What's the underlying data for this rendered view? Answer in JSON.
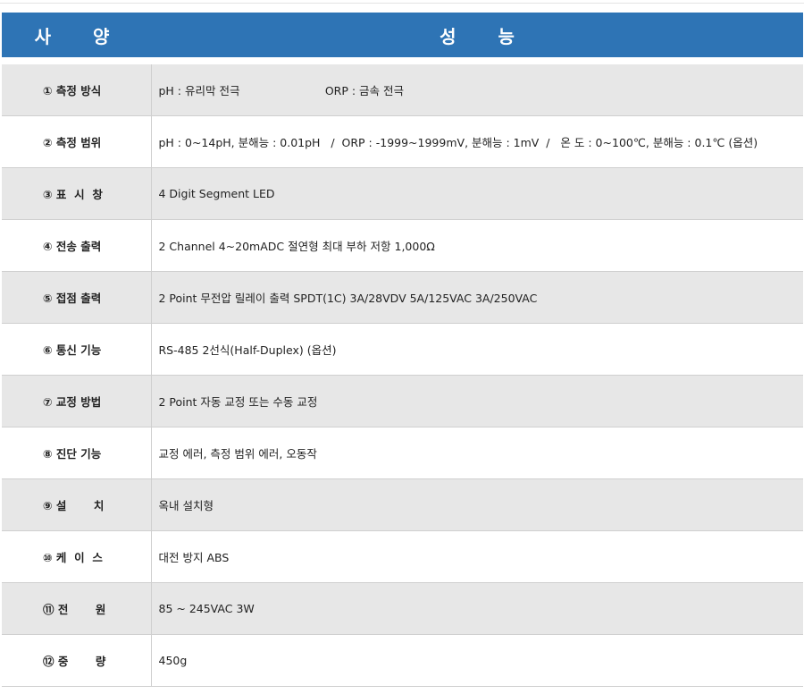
{
  "header": {
    "item_label": "사 양",
    "perf_label": "성 능"
  },
  "rows": [
    {
      "item": "① 측정 방식",
      "perf": "pH : 유리막 전극                        ORP : 금속 전극"
    },
    {
      "item": "② 측정 범위",
      "perf": "pH : 0~14pH, 분해능 : 0.01pH   /  ORP : -1999~1999mV, 분해능 : 1mV  /   온 도 : 0~100℃, 분해능 : 0.1℃ (옵션)"
    },
    {
      "item": "③ 표  시  창",
      "perf": "4 Digit Segment LED"
    },
    {
      "item": "④ 전송 출력",
      "perf": "2 Channel 4~20mADC 절연형 최대 부하 저항 1,000Ω"
    },
    {
      "item": "⑤ 접점 출력",
      "perf": "2 Point 무전압 릴레이 출력 SPDT(1C) 3A/28VDV 5A/125VAC 3A/250VAC"
    },
    {
      "item": "⑥ 통신 기능",
      "perf": "RS-485 2선식(Half-Duplex) (옵션)"
    },
    {
      "item": "⑦ 교정 방법",
      "perf": "2 Point 자동 교정 또는 수동 교정"
    },
    {
      "item": "⑧ 진단 기능",
      "perf": "교정 에러, 측정 범위 에러, 오동작"
    },
    {
      "item": "⑨ 설       치",
      "perf": "옥내 설치형"
    },
    {
      "item": "⑩ 케  이  스",
      "perf": "대전 방지 ABS"
    },
    {
      "item": "⑪ 전       원",
      "perf": "85 ~ 245VAC 3W"
    },
    {
      "item": "⑫ 중       량",
      "perf": "450g"
    }
  ]
}
